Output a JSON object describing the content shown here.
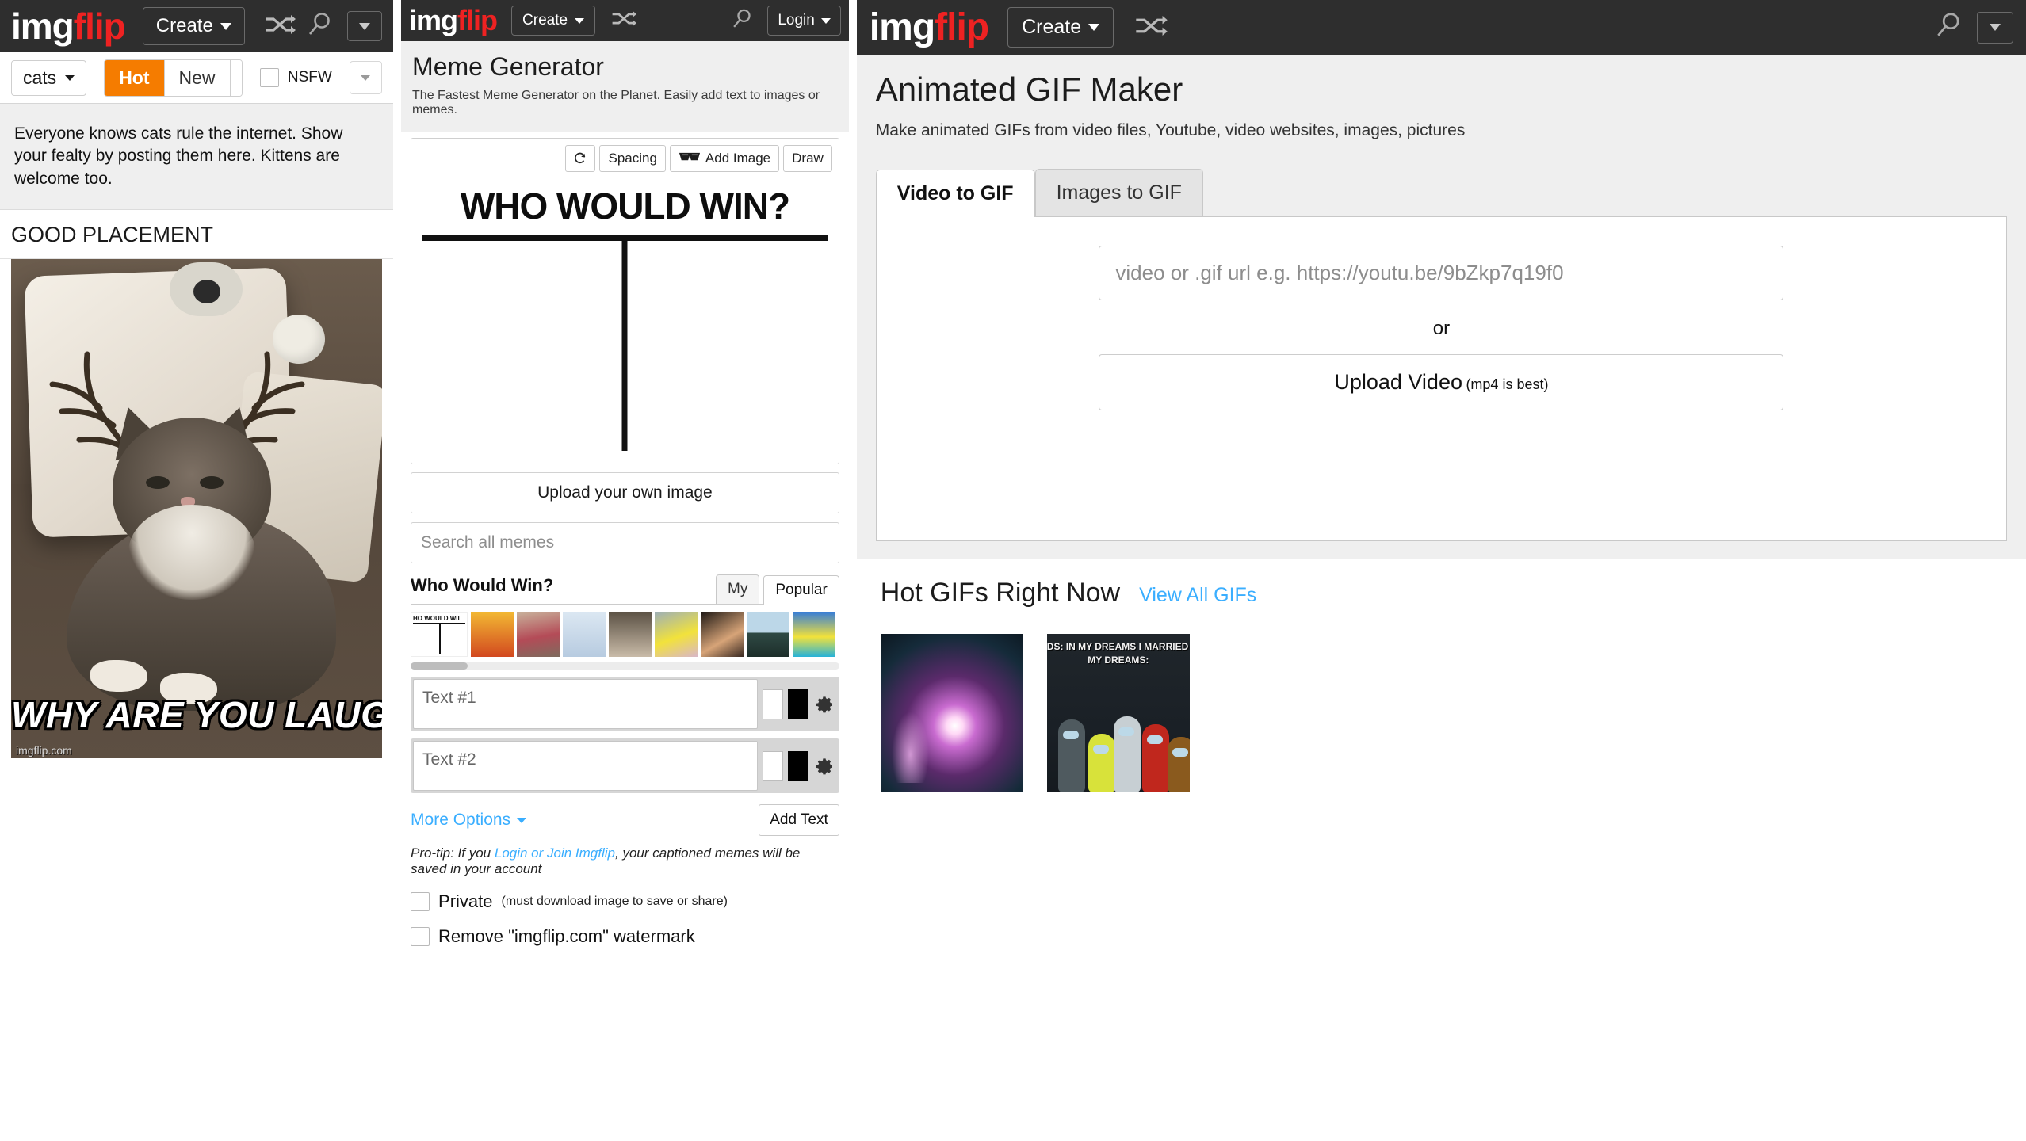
{
  "brand": {
    "name_part1": "img",
    "name_part2": "flip",
    "accent": "#ee2222",
    "nav_bg": "#2e2e2e"
  },
  "panel_a": {
    "nav": {
      "create_label": "Create",
      "shuffle_icon": "shuffle-icon",
      "search_icon": "search-icon",
      "dropdown_icon": "chevron-down-icon"
    },
    "subbar": {
      "stream_select": "cats",
      "sort_hot": "Hot",
      "sort_new": "New",
      "nsfw_label": "NSFW",
      "nsfw_checked": false,
      "active_sort": "Hot",
      "hot_color": "#f57c00"
    },
    "description": "Everyone knows cats rule the internet. Show your fealty by posting them here. Kittens are welcome too.",
    "post": {
      "title": "GOOD PLACEMENT",
      "caption": "WHY ARE YOU LAUGHING?",
      "watermark": "imgflip.com"
    }
  },
  "panel_b": {
    "nav": {
      "create_label": "Create",
      "login_label": "Login"
    },
    "title": "Meme Generator",
    "subtitle": "The Fastest Meme Generator on the Planet. Easily add text to images or memes.",
    "toolbar": [
      {
        "label": "",
        "icon": "rotate-icon",
        "name": "reset-button"
      },
      {
        "label": "Spacing",
        "icon": "",
        "name": "spacing-button"
      },
      {
        "label": "Add Image",
        "icon": "sunglasses-icon",
        "name": "add-image-button"
      },
      {
        "label": "Draw",
        "icon": "",
        "name": "draw-button"
      }
    ],
    "canvas_text": "WHO WOULD WIN?",
    "upload_label": "Upload your own image",
    "search_placeholder": "Search all memes",
    "meme_list_title": "Who Would Win?",
    "list_tabs": [
      {
        "label": "My",
        "active": false
      },
      {
        "label": "Popular",
        "active": true
      }
    ],
    "text_inputs": [
      {
        "placeholder": "Text #1",
        "value": "",
        "color_fill": "#ffffff",
        "color_outline": "#000000",
        "gear": "gear-icon"
      },
      {
        "placeholder": "Text #2",
        "value": "",
        "color_fill": "#ffffff",
        "color_outline": "#000000",
        "gear": "gear-icon"
      }
    ],
    "more_options_label": "More Options",
    "add_text_label": "Add Text",
    "protip_prefix": "Pro-tip: If you ",
    "protip_link": "Login or Join Imgflip",
    "protip_suffix": ", your captioned memes will be saved in your account",
    "private_label": "Private",
    "private_note": "(must download image to save or share)",
    "watermark_label": "Remove \"imgflip.com\" watermark"
  },
  "panel_c": {
    "nav": {
      "create_label": "Create"
    },
    "title": "Animated GIF Maker",
    "subtitle": "Make animated GIFs from video files, Youtube, video websites, images, pictures",
    "tabs": [
      {
        "label": "Video to GIF",
        "active": true
      },
      {
        "label": "Images to GIF",
        "active": false
      }
    ],
    "url_placeholder": "video or .gif url e.g. https://youtu.be/9bZkp7q19f0",
    "or_label": "or",
    "upload_label": "Upload Video",
    "upload_note": "(mp4 is best)",
    "hot_title": "Hot GIFs Right Now",
    "view_all_label": "View All GIFs",
    "view_all_color": "#3aaeff",
    "gifs": [
      {
        "caption": ""
      },
      {
        "caption": "DS: IN MY DREAMS I MARRIED M",
        "caption2": "MY DREAMS:"
      }
    ]
  }
}
